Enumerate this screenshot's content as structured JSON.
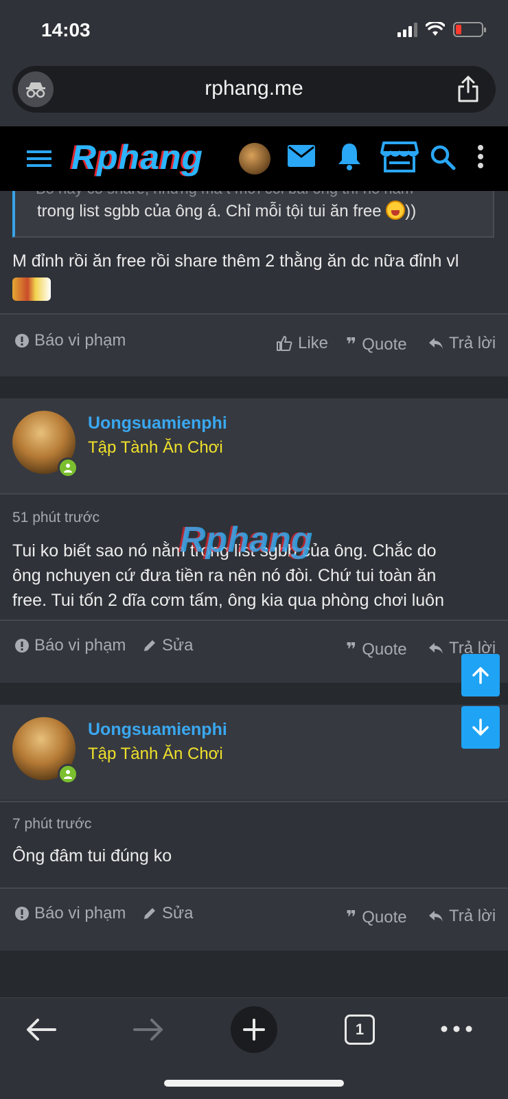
{
  "status": {
    "time": "14:03"
  },
  "browser": {
    "url": "rphang.me",
    "tab_count": "1"
  },
  "site": {
    "logo_text": "Rphang"
  },
  "watermark": "Rphang",
  "quote": {
    "ghost_line": "Bố hay có share, nhưng mà t mới coi bài ông thì nó nằm",
    "text": "trong list sgbb của ông á. Chỉ mỗi tội tui ăn free",
    "tail": "))"
  },
  "first_post": {
    "message": "M đỉnh rồi ăn free rồi share thêm 2 thằng ăn dc nữa đỉnh vl",
    "actions": {
      "report": "Báo vi phạm",
      "like": "Like",
      "quote": "Quote",
      "reply": "Trả lời"
    }
  },
  "posts": [
    {
      "username": "Uongsuamienphi",
      "title": "Tập Tành Ăn Chơi",
      "time": "51 phút trước",
      "lines": [
        "Tui ko biết sao nó nằm trong list sgbb của ông. Chắc do",
        "ông nchuyen cứ đưa tiền ra nên nó đòi. Chứ tui toàn ăn",
        "free. Tui tốn 2 dĩa cơm tấm, ông kia qua phòng chơi luôn"
      ],
      "actions": {
        "report": "Báo vi phạm",
        "edit": "Sửa",
        "quote": "Quote",
        "reply": "Trả lời"
      }
    },
    {
      "username": "Uongsuamienphi",
      "title": "Tập Tành Ăn Chơi",
      "time": "7 phút trước",
      "lines": [
        "Ông đâm tui đúng ko"
      ],
      "actions": {
        "report": "Báo vi phạm",
        "edit": "Sửa",
        "quote": "Quote",
        "reply": "Trả lời"
      }
    }
  ],
  "colors": {
    "accent": "#3aa8f0",
    "user_title": "#f0e12b",
    "scroll_button": "#1fa3f5",
    "online": "#7bbf2f"
  }
}
